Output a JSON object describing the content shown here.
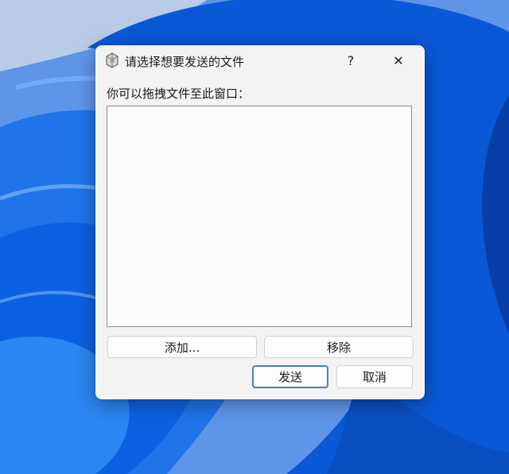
{
  "dialog": {
    "title": "请选择想要发送的文件",
    "help_label": "?",
    "close_label": "✕",
    "instruction": "你可以拖拽文件至此窗口：",
    "file_list": [],
    "add_label": "添加...",
    "remove_label": "移除",
    "send_label": "发送",
    "cancel_label": "取消"
  },
  "colors": {
    "wallpaper_blue": "#0a5fd9",
    "dialog_bg": "#f3f3f3",
    "default_button_border": "#4b7fb8"
  },
  "icons": {
    "app": "app-icon",
    "help": "help-icon",
    "close": "close-icon"
  }
}
